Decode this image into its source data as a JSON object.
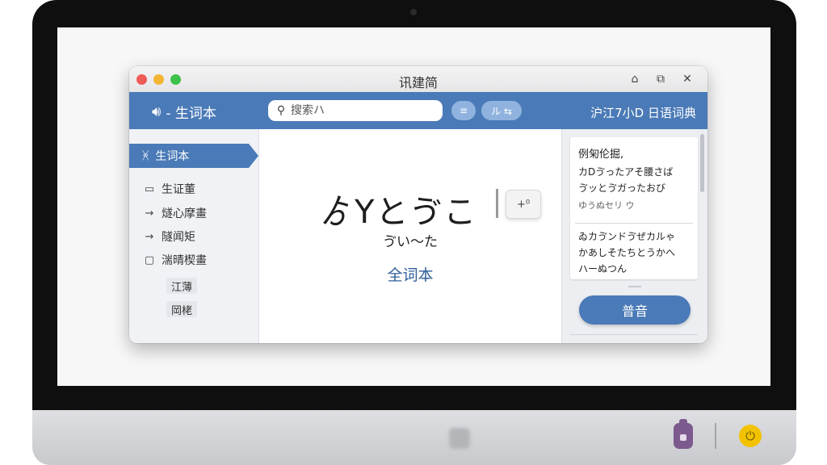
{
  "window": {
    "title": "讯建简"
  },
  "titlebar_icons": [
    "lock-icon",
    "tab-icon",
    "close-icon"
  ],
  "titlebar_glyphs": {
    "lock": "⌂",
    "tab": "⧉",
    "close": "✕"
  },
  "toolbar": {
    "brand_icon_glyph": "🔊︎",
    "brand_label": "- 生词本",
    "search_placeholder": "搜索ハ",
    "filter_icon_glyph": "≡",
    "toggle_label": "ル ⇆",
    "dict_title": "沪江7小D 日语词典"
  },
  "sidebar": {
    "active": {
      "icon_glyph": "ᚸ",
      "label": "生词本"
    },
    "items": [
      {
        "icon": "folder-icon",
        "glyph": "▭",
        "label": "生证董"
      },
      {
        "icon": "arrow-right-icon",
        "glyph": "→",
        "label": "燧心摩畫"
      },
      {
        "icon": "arrow-right-icon",
        "glyph": "→",
        "label": "隧闻矩"
      },
      {
        "icon": "calendar-icon",
        "glyph": "▢",
        "label": "湍晴楔畫"
      }
    ],
    "sub_items": [
      {
        "label": "江薄"
      },
      {
        "label": "岡栳"
      }
    ]
  },
  "word": {
    "headword": "ゟYとゔこ",
    "add_card_glyph": "+⁰",
    "reading": "ゔい〜た",
    "vocab_link": "全词本"
  },
  "examples": {
    "heading": "例匊伦掘,",
    "lines_a": [
      "カDゔったアそ腰さば",
      "ゔッとゔガったおび",
      "ゆうぬセリ ウ"
    ],
    "lines_b": [
      "ゐカゔンドゔぜカルゃ",
      "かあしそたちとうかへ",
      "ハーぬつん"
    ]
  },
  "panel": {
    "play_label": "普音"
  },
  "colors": {
    "accent": "#4a7ab7",
    "link": "#2e5e9a",
    "close_red": "#ef5b55",
    "minimize_yellow": "#f3b532",
    "maximize_green": "#3fc24b"
  }
}
